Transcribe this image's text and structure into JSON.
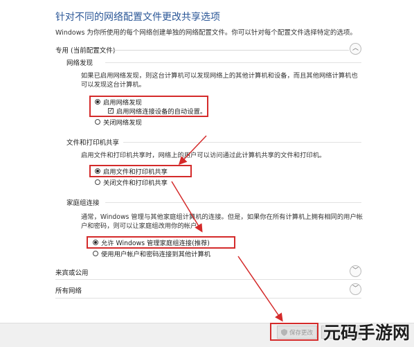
{
  "page": {
    "title": "针对不同的网络配置文件更改共享选项",
    "description": "Windows 为你所使用的每个网络创建单独的网络配置文件。你可以针对每个配置文件选择特定的选项。"
  },
  "private_section": {
    "header": "专用 (当前配置文件)",
    "network_discovery": {
      "heading": "网络发现",
      "text_line1": "如果已启用网络发现，则这台计算机可以发现网络上的其他计算机和设备，而且其他网络计算机也",
      "text_line2": "可以发现这台计算机。",
      "opt_on": "启用网络发现",
      "opt_auto": "启用网络连接设备的自动设置。",
      "opt_off": "关闭网络发现"
    },
    "file_printer": {
      "heading": "文件和打印机共享",
      "text_line1": "启用文件和打印机共享时，网络上的用户可以访问通过此计算机共享的文件和打印机。",
      "opt_on": "启用文件和打印机共享",
      "opt_off": "关闭文件和打印机共享"
    },
    "homegroup": {
      "heading": "家庭组连接",
      "text_line1": "通常，Windows 管理与其他家庭组计算机的连接。但是，如果你在所有计算机上拥有相同的用户帐",
      "text_line2": "户和密码，则可以让家庭组改用你的帐户。",
      "opt_on": "允许 Windows 管理家庭组连接(推荐)",
      "opt_off": "使用用户帐户和密码连接到其他计算机"
    }
  },
  "guest_section": {
    "header": "来宾或公用"
  },
  "all_section": {
    "header": "所有网络"
  },
  "buttons": {
    "save": "保存更改",
    "cancel": ""
  },
  "watermark": "元码手游网",
  "colors": {
    "title": "#2b5797",
    "highlight": "#d42a2a"
  }
}
